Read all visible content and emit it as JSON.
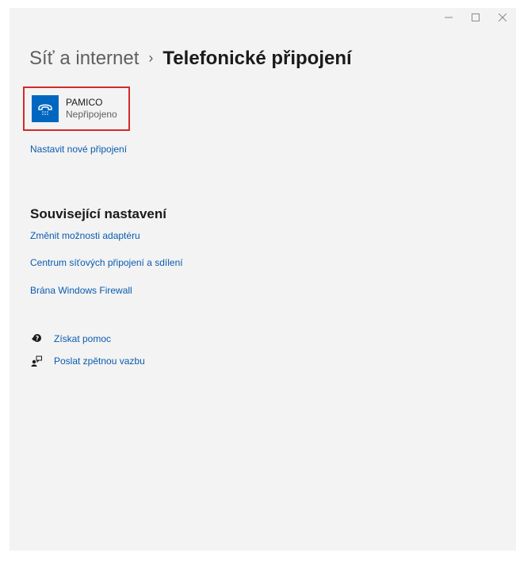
{
  "window": {
    "controls": {
      "minimize": "–",
      "maximize": "□",
      "close": "✕"
    }
  },
  "header": {
    "breadcrumb_parent": "Síť a internet",
    "separator": "›",
    "current_page": "Telefonické připojení"
  },
  "connection": {
    "icon": "dialup-phone-icon",
    "name": "PAMICO",
    "status": "Nepřipojeno"
  },
  "links": {
    "setup_new": "Nastavit nové připojení"
  },
  "related": {
    "title": "Související nastavení",
    "items": [
      {
        "label": "Změnit možnosti adaptéru"
      },
      {
        "label": "Centrum síťových připojení a sdílení"
      },
      {
        "label": "Brána Windows Firewall"
      }
    ]
  },
  "help": {
    "get_help": {
      "label": "Získat pomoc",
      "icon": "help-icon"
    },
    "feedback": {
      "label": "Poslat zpětnou vazbu",
      "icon": "feedback-icon"
    }
  },
  "colors": {
    "accent": "#0067c0",
    "link": "#0a5bb0",
    "highlight_border": "#d42a2a",
    "background": "#f3f3f3"
  }
}
